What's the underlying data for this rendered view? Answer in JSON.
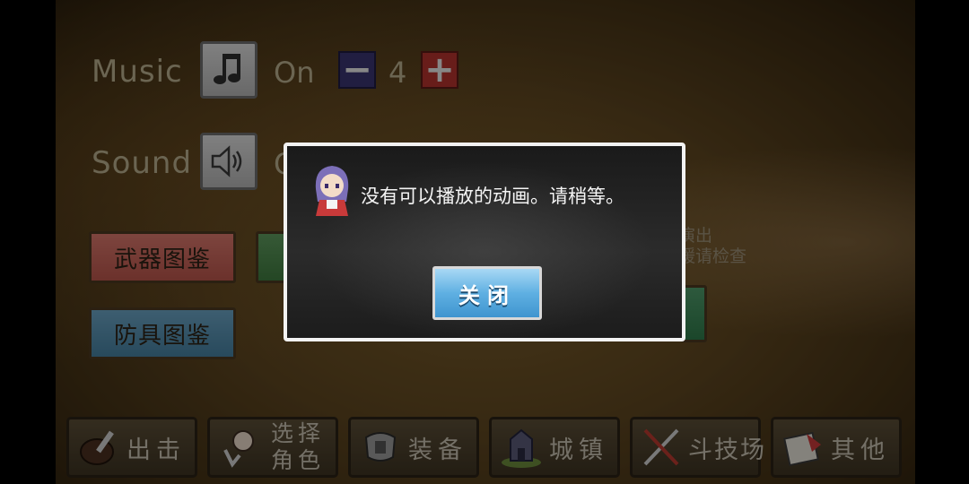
{
  "settings": {
    "music": {
      "label": "Music",
      "icon": "music-note-icon",
      "state": "On",
      "volume": "4",
      "minus": "−",
      "plus": "+"
    },
    "sound": {
      "label": "Sound",
      "icon": "speaker-icon",
      "state_partial": "O"
    }
  },
  "books": {
    "weapon": "武器图鉴",
    "armor": "防具图鉴"
  },
  "faded_text": {
    "line1": "演出",
    "line2": "缓请检查"
  },
  "nav": [
    {
      "label": "出击",
      "icon": "sortie-icon"
    },
    {
      "label1": "选择",
      "label2": "角色",
      "icon": "character-select-icon"
    },
    {
      "label": "装备",
      "icon": "equipment-icon"
    },
    {
      "label": "城镇",
      "icon": "town-icon"
    },
    {
      "label": "斗技场",
      "icon": "arena-icon"
    },
    {
      "label": "其他",
      "icon": "other-icon"
    }
  ],
  "dialog": {
    "message": "没有可以播放的动画。请稍等。",
    "close_label": "关闭",
    "avatar": "character-avatar-icon"
  },
  "colors": {
    "weapon_button": "#c8645a",
    "armor_button": "#4f8cad",
    "close_button": "#5fb0e2",
    "minus_button": "#3a3570",
    "plus_button": "#b3322d"
  }
}
